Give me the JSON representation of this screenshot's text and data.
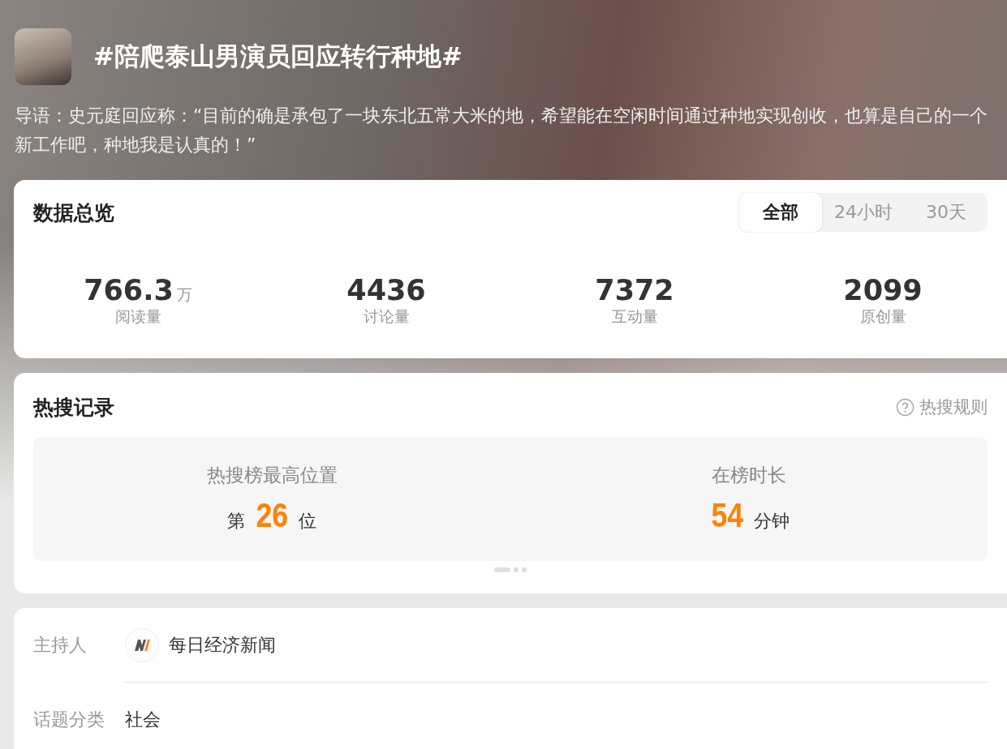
{
  "header": {
    "title": "#陪爬泰山男演员回应转行种地#",
    "intro": "导语：史元庭回应称：“目前的确是承包了一块东北五常大米的地，希望能在空闲时间通过种地实现创收，也算是自己的一个新工作吧，种地我是认真的！”"
  },
  "overview": {
    "title": "数据总览",
    "tabs": [
      {
        "label": "全部",
        "selected": true
      },
      {
        "label": "24小时",
        "selected": false
      },
      {
        "label": "30天",
        "selected": false
      }
    ],
    "stats": [
      {
        "value": "766.3",
        "unit": "万",
        "label": "阅读量"
      },
      {
        "value": "4436",
        "label": "讨论量"
      },
      {
        "value": "7372",
        "label": "互动量"
      },
      {
        "value": "2099",
        "label": "原创量"
      }
    ]
  },
  "hot_search": {
    "title": "热搜记录",
    "rules_link": "热搜规则",
    "items": [
      {
        "label": "热搜榜最高位置",
        "prefix": "第",
        "value": "26",
        "suffix": "位"
      },
      {
        "label": "在榜时长",
        "value": "54",
        "suffix": "分钟"
      }
    ],
    "pager": [
      {
        "selected": true
      },
      {
        "selected": false
      },
      {
        "selected": false
      }
    ]
  },
  "details": [
    {
      "kind": "host",
      "label": "主持人",
      "value": "每日经济新闻"
    },
    {
      "kind": "plain",
      "label": "话题分类",
      "value": "社会"
    }
  ]
}
